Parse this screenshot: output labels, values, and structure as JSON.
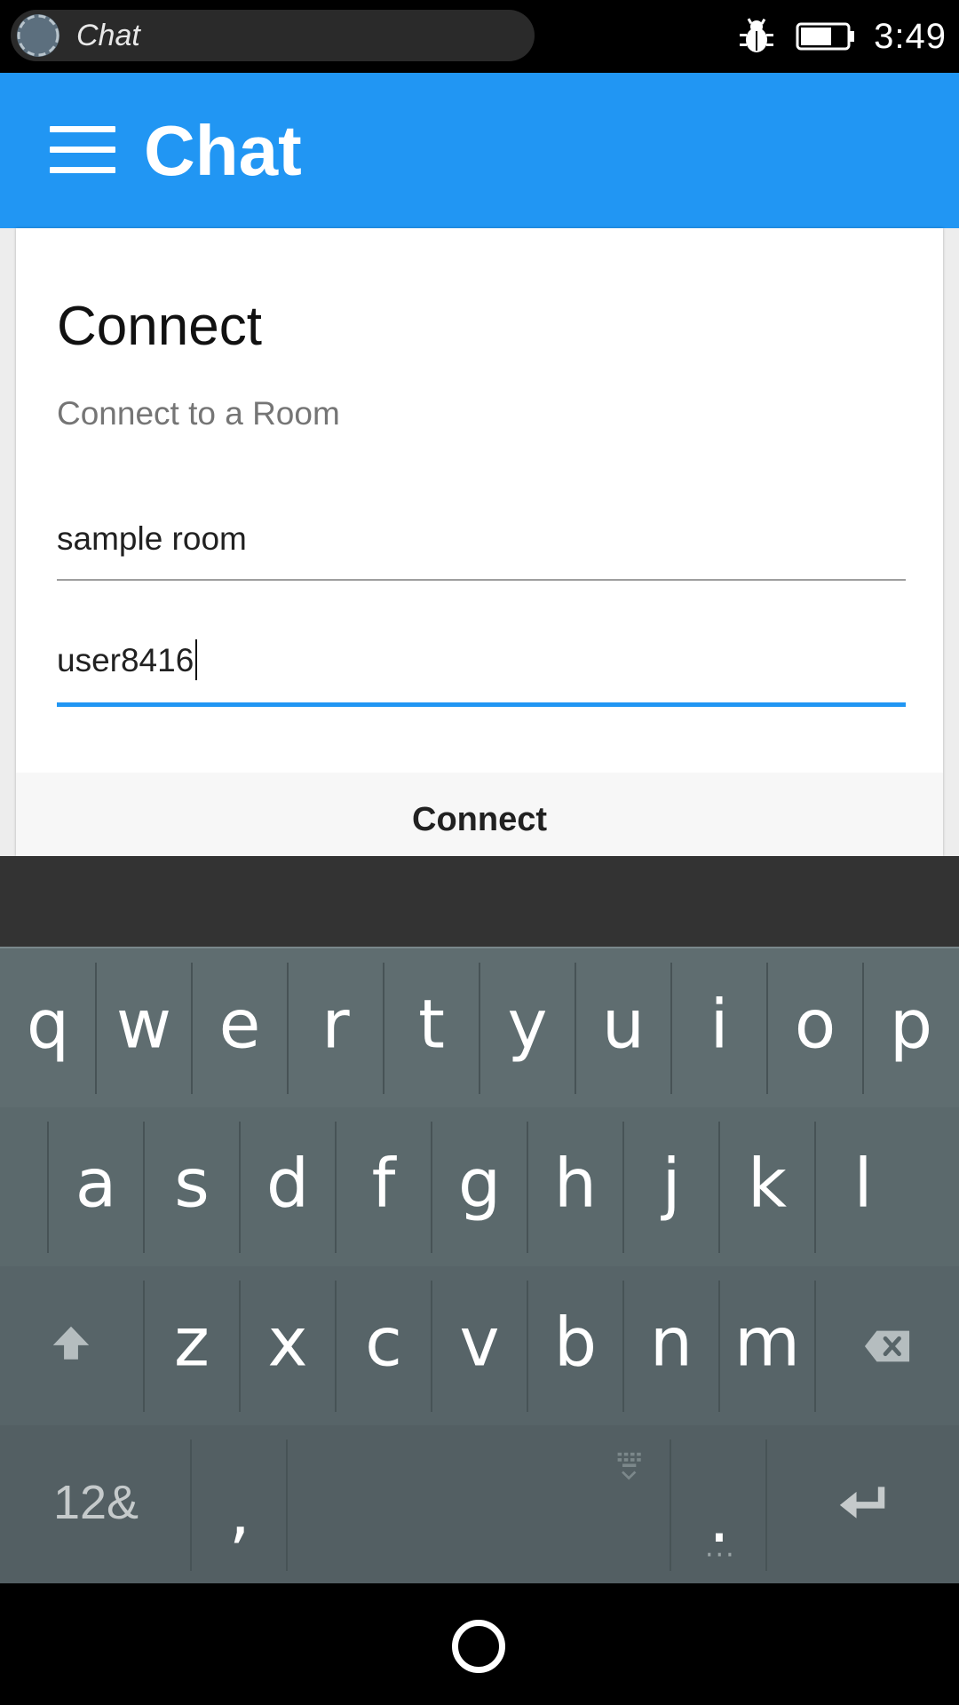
{
  "status_bar": {
    "notification_text": "Chat",
    "time": "3:49"
  },
  "app_bar": {
    "title": "Chat"
  },
  "card": {
    "title": "Connect",
    "subtitle": "Connect to a Room",
    "room_field_value": "sample room",
    "username_field_value": "user8416",
    "connect_label": "Connect"
  },
  "keyboard": {
    "row1": [
      "q",
      "w",
      "e",
      "r",
      "t",
      "y",
      "u",
      "i",
      "o",
      "p"
    ],
    "row2": [
      "a",
      "s",
      "d",
      "f",
      "g",
      "h",
      "j",
      "k",
      "l"
    ],
    "row3": [
      "z",
      "x",
      "c",
      "v",
      "b",
      "n",
      "m"
    ],
    "symbols_label": "12&",
    "comma_label": ",",
    "period_label": "."
  },
  "colors": {
    "primary": "#2196F3",
    "keyboard_bg": "#58666a"
  }
}
